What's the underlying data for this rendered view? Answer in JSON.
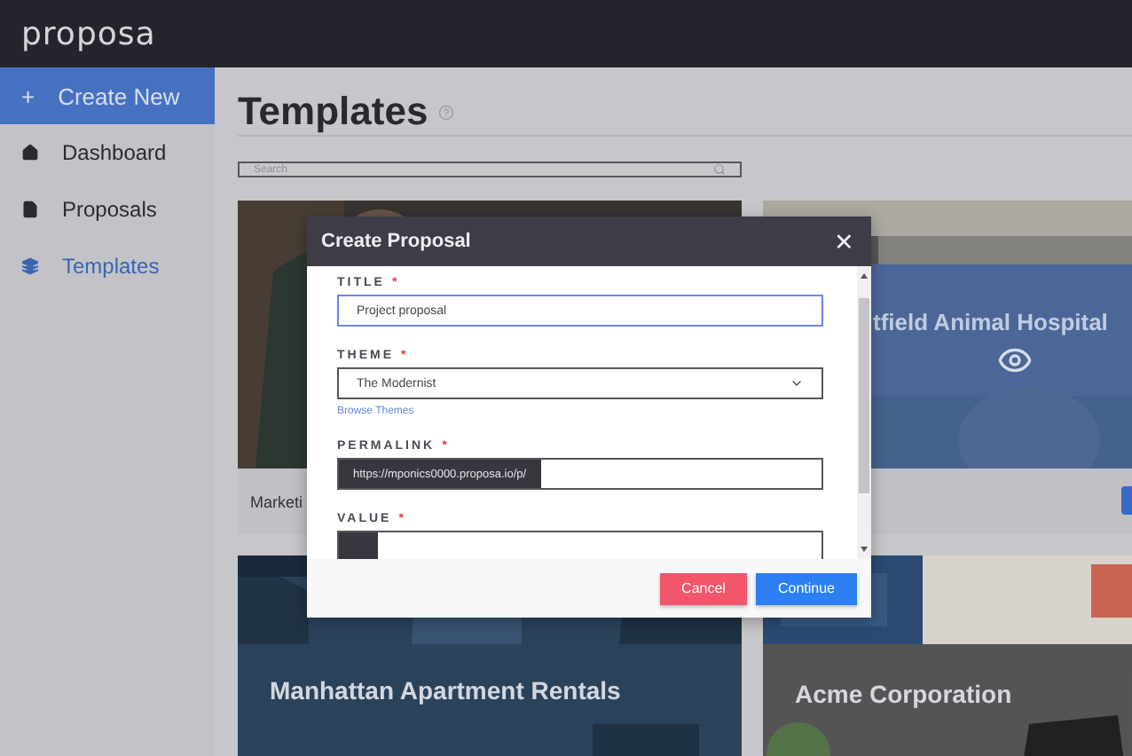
{
  "app": {
    "logo": "proposa"
  },
  "sidebar": {
    "create_button": {
      "icon": "+",
      "label": "Create New"
    },
    "items": [
      {
        "label": "Dashboard",
        "selected": false
      },
      {
        "label": "Proposals",
        "selected": false
      },
      {
        "label": "Templates",
        "selected": true
      }
    ]
  },
  "page": {
    "title": "Templates",
    "search": {
      "placeholder": "Search"
    }
  },
  "templates": [
    {
      "kind": "caption",
      "text": "Marketi"
    },
    {
      "kind": "hover",
      "text": "tfield Animal Hospital"
    },
    {
      "kind": "banner",
      "text": "Manhattan Apartment Rentals"
    },
    {
      "kind": "banner",
      "text": "Acme Corporation"
    }
  ],
  "modal": {
    "title": "Create Proposal",
    "close": "✕",
    "fields": [
      {
        "kind": "text",
        "label": "TITLE",
        "required_mark": "*",
        "value": "Project proposal",
        "focused": true
      },
      {
        "kind": "select",
        "label": "THEME",
        "required_mark": "*",
        "value": "The Modernist",
        "link": "Browse Themes"
      },
      {
        "kind": "prefixed",
        "label": "PERMALINK",
        "required_mark": "*",
        "prefix": "https://mponics0000.proposa.io/p/"
      },
      {
        "kind": "prefixed",
        "label": "VALUE",
        "required_mark": "*"
      }
    ],
    "buttons": [
      {
        "kind": "cancel",
        "label": "Cancel"
      },
      {
        "kind": "primary",
        "label": "Continue"
      }
    ]
  }
}
